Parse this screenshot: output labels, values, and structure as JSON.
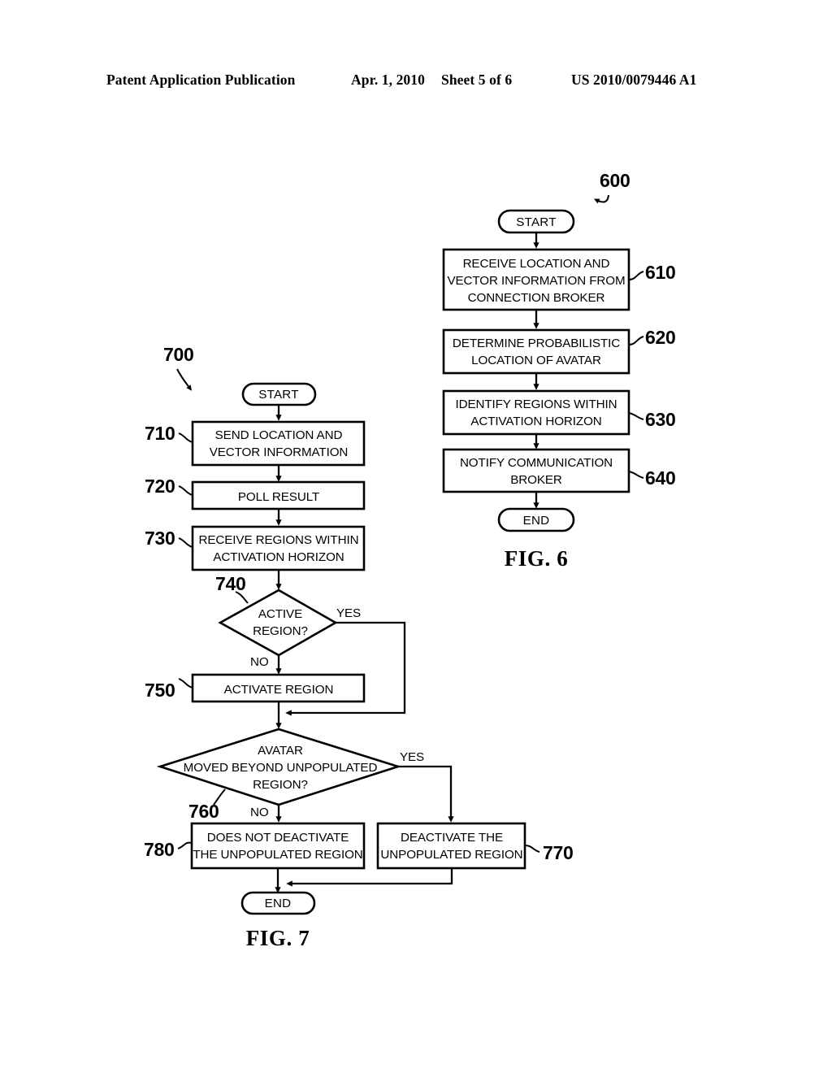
{
  "header": {
    "publication": "Patent Application Publication",
    "date": "Apr. 1, 2010",
    "sheet": "Sheet 5 of 6",
    "patent_number": "US 2010/0079446 A1"
  },
  "figures": [
    {
      "id": "fig6",
      "caption": "FIG. 6",
      "diagram_ref": "600",
      "nodes": {
        "start": "START",
        "end": "END",
        "n610": "RECEIVE LOCATION AND VECTOR INFORMATION FROM CONNECTION BROKER",
        "n610_l1": "RECEIVE LOCATION AND",
        "n610_l2": "VECTOR INFORMATION FROM",
        "n610_l3": "CONNECTION BROKER",
        "n620_l1": "DETERMINE PROBABILISTIC",
        "n620_l2": "LOCATION OF AVATAR",
        "n630_l1": "IDENTIFY REGIONS WITHIN",
        "n630_l2": "ACTIVATION HORIZON",
        "n640_l1": "NOTIFY COMMUNICATION",
        "n640_l2": "BROKER"
      },
      "refs": {
        "r610": "610",
        "r620": "620",
        "r630": "630",
        "r640": "640"
      }
    },
    {
      "id": "fig7",
      "caption": "FIG. 7",
      "diagram_ref": "700",
      "nodes": {
        "start": "START",
        "end": "END",
        "n710_l1": "SEND LOCATION AND",
        "n710_l2": "VECTOR INFORMATION",
        "n720_l1": "POLL RESULT",
        "n730_l1": "RECEIVE REGIONS WITHIN",
        "n730_l2": "ACTIVATION HORIZON",
        "n740_l1": "ACTIVE",
        "n740_l2": "REGION?",
        "n750_l1": "ACTIVATE REGION",
        "n760_l1": "AVATAR",
        "n760_l2": "MOVED BEYOND UNPOPULATED",
        "n760_l3": "REGION?",
        "n770_l1": "DEACTIVATE THE",
        "n770_l2": "UNPOPULATED REGION",
        "n780_l1": "DOES NOT DEACTIVATE",
        "n780_l2": "THE UNPOPULATED REGION"
      },
      "refs": {
        "r710": "710",
        "r720": "720",
        "r730": "730",
        "r740": "740",
        "r750": "750",
        "r760": "760",
        "r770": "770",
        "r780": "780"
      },
      "branch_labels": {
        "yes_740": "YES",
        "no_740": "NO",
        "yes_760": "YES",
        "no_760": "NO"
      }
    }
  ],
  "colors": {
    "ink": "#000000",
    "paper": "#ffffff"
  }
}
